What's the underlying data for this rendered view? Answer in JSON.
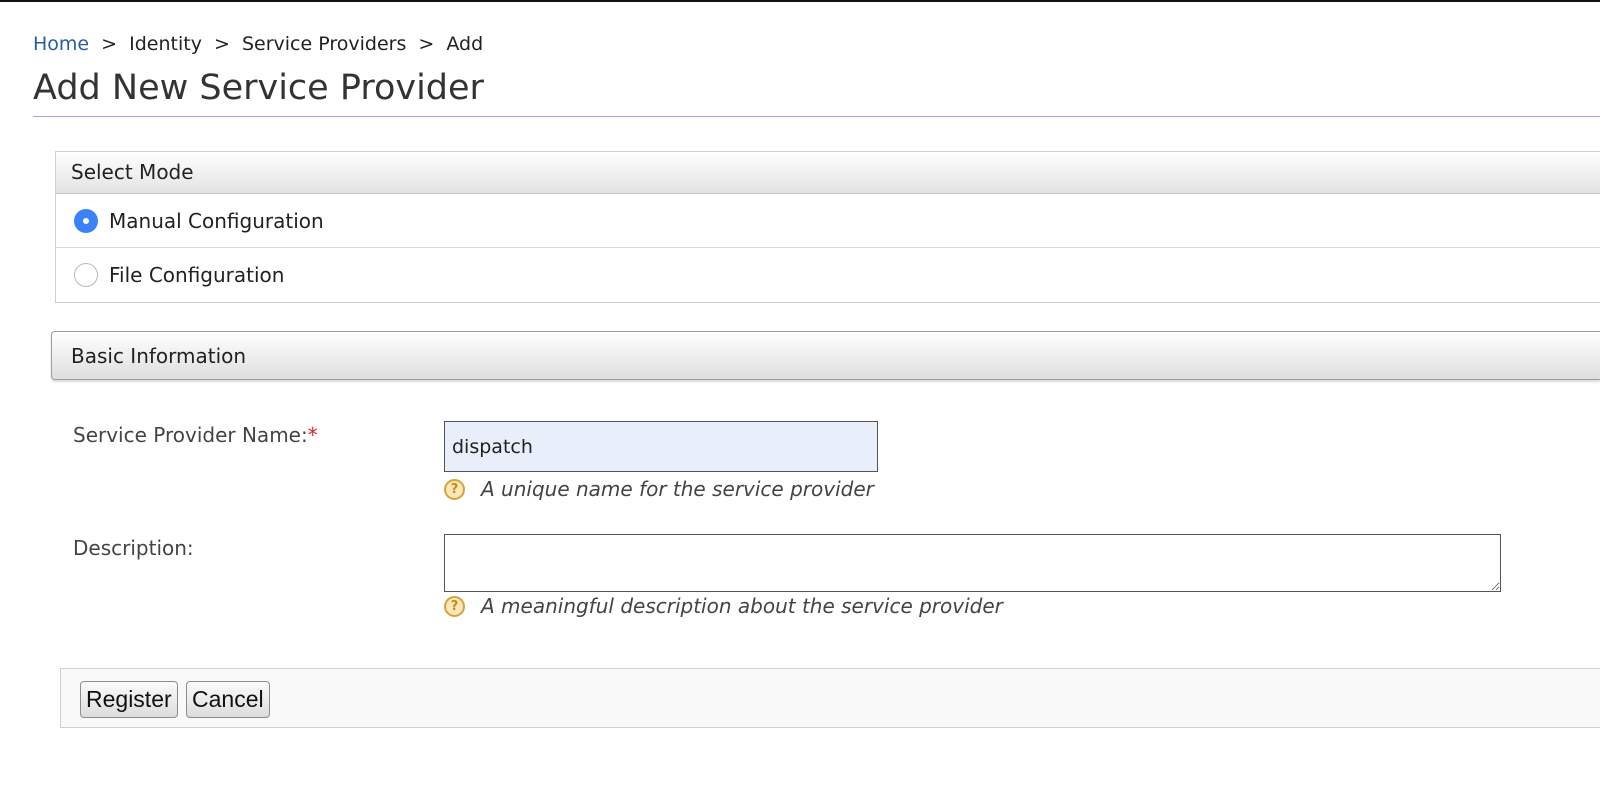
{
  "breadcrumb": {
    "items": [
      "Home",
      "Identity",
      "Service Providers",
      "Add"
    ],
    "separator": ">"
  },
  "page": {
    "title": "Add New Service Provider"
  },
  "select_mode": {
    "title": "Select Mode",
    "options": [
      {
        "label": "Manual Configuration",
        "checked": true
      },
      {
        "label": "File Configuration",
        "checked": false
      }
    ]
  },
  "basic_info": {
    "title": "Basic Information",
    "name_field": {
      "label": "Service Provider Name:",
      "required_mark": "*",
      "value": "dispatch",
      "help": "A unique name for the service provider"
    },
    "description_field": {
      "label": "Description:",
      "value": "",
      "help": "A meaningful description about the service provider"
    }
  },
  "actions": {
    "register_label": "Register",
    "cancel_label": "Cancel"
  },
  "colors": {
    "link": "#2a5d9f",
    "radio_checked": "#3b82f6",
    "required": "#e02020",
    "input_bg": "#e8effb",
    "help_icon": "#d8a23a"
  },
  "icons": {
    "help": "question-circle-icon"
  }
}
